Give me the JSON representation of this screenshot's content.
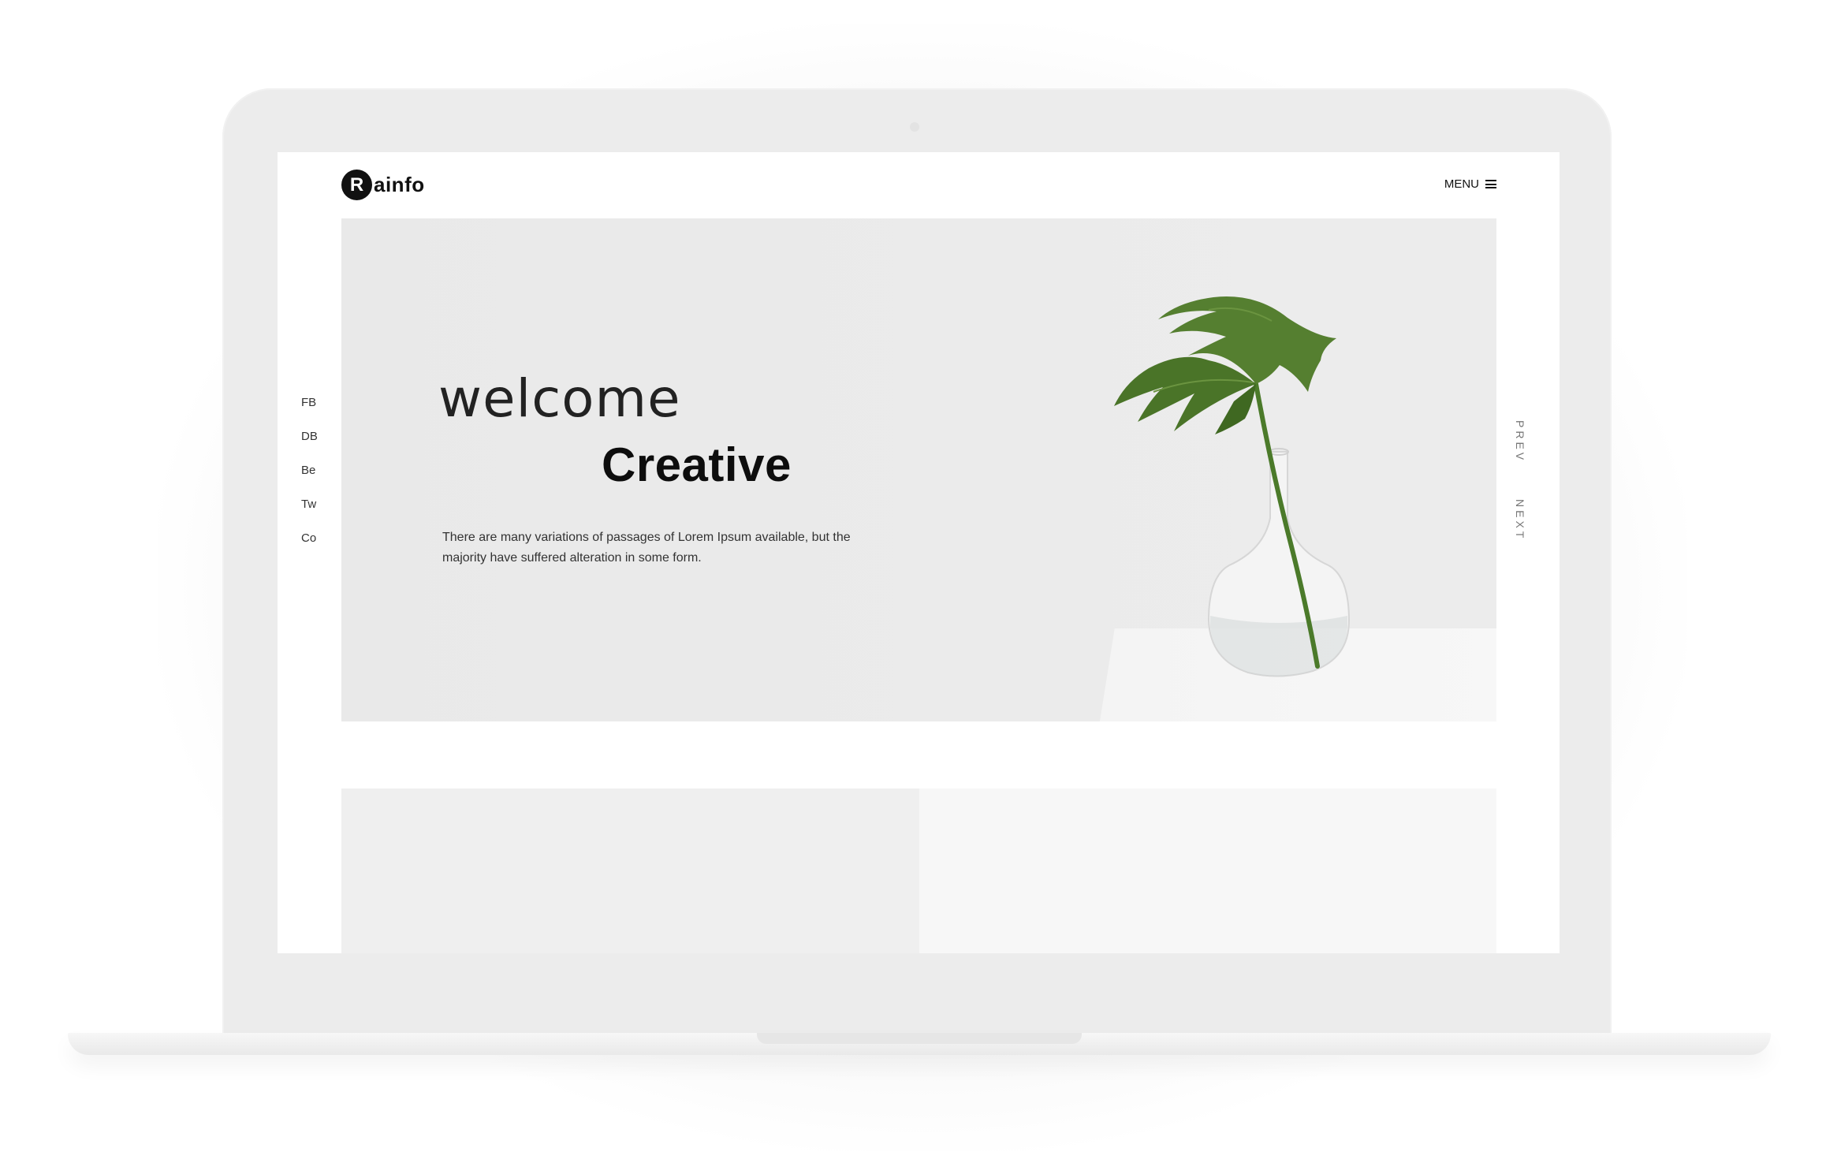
{
  "header": {
    "logo_mark": "R",
    "logo_text": "ainfo",
    "menu_label": "MENU"
  },
  "social": {
    "items": [
      {
        "label": "FB"
      },
      {
        "label": "DB"
      },
      {
        "label": "Be"
      },
      {
        "label": "Tw"
      },
      {
        "label": "Co"
      }
    ]
  },
  "hero": {
    "welcome": "welcome",
    "headline": "Creative",
    "description": "There are many variations of passages of Lorem Ipsum available, but the majority have suffered alteration in some form."
  },
  "slider_nav": {
    "prev": "PREV",
    "next": "NEXT"
  },
  "icons": {
    "menu": "hamburger-icon",
    "plant": "monstera-plant-illustration"
  },
  "colors": {
    "text": "#111111",
    "hero_bg": "#ebebeb",
    "leaf": "#4f7a2c"
  }
}
